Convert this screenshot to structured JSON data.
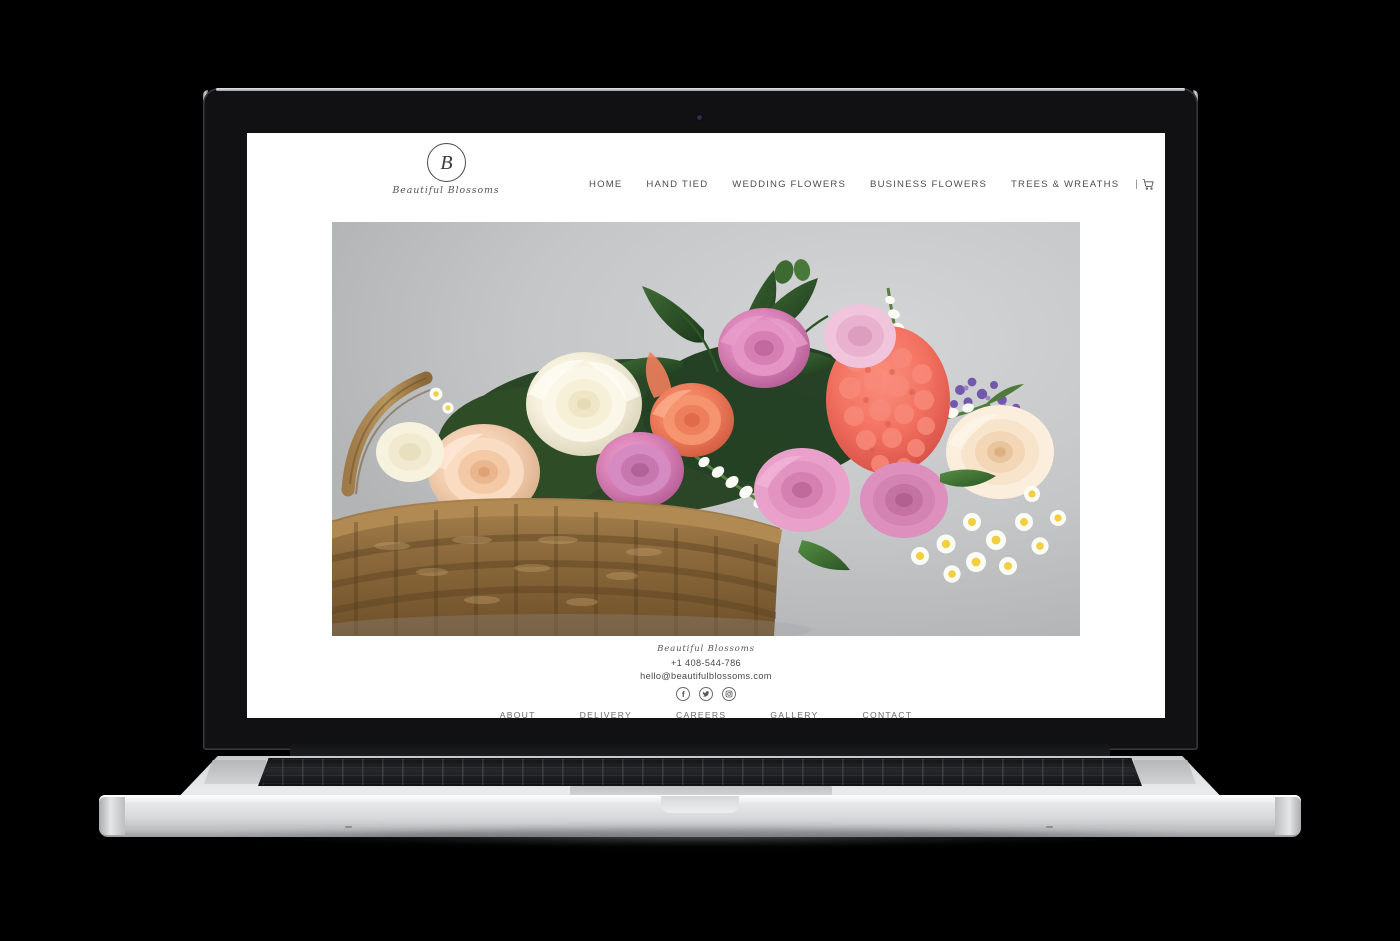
{
  "device": {
    "type": "laptop-mockup",
    "model": "macbook-pro",
    "webcam_label": "webcam"
  },
  "site": {
    "brand": {
      "monogram": "B",
      "name": "Beautiful Blossoms",
      "logo_icon": "circle-monogram-icon"
    },
    "nav": {
      "items": [
        {
          "label": "HOME"
        },
        {
          "label": "HAND TIED"
        },
        {
          "label": "WEDDING FLOWERS"
        },
        {
          "label": "BUSINESS FLOWERS"
        },
        {
          "label": "TREES & WREATHS"
        }
      ],
      "separator": "|",
      "cart_icon": "shopping-cart-icon",
      "cart_label": "Cart"
    },
    "hero": {
      "alt": "Wicker basket filled with cream, peach and pink roses, coral flowers, white veronica spikes, yellow-centred daisies and purple statice against a pale grey wall",
      "background_color": "#c5c7c9"
    },
    "footer": {
      "brand_name": "Beautiful Blossoms",
      "phone": "+1 408-544-786",
      "email": "hello@beautifulblossoms.com",
      "social": [
        {
          "name": "facebook-icon",
          "label": "Facebook"
        },
        {
          "name": "twitter-icon",
          "label": "Twitter"
        },
        {
          "name": "instagram-icon",
          "label": "Instagram"
        }
      ],
      "links": [
        {
          "label": "ABOUT"
        },
        {
          "label": "DELIVERY"
        },
        {
          "label": "CAREERS"
        },
        {
          "label": "GALLERY"
        },
        {
          "label": "CONTACT"
        }
      ]
    }
  },
  "colors": {
    "page_background": "#000000",
    "site_background": "#ffffff",
    "nav_text": "#4e4e4e",
    "footer_text": "#6a6a6a",
    "hero_wall": "#c5c7c9",
    "lid_black": "#111113",
    "base_silver": "#e0e2e4"
  }
}
